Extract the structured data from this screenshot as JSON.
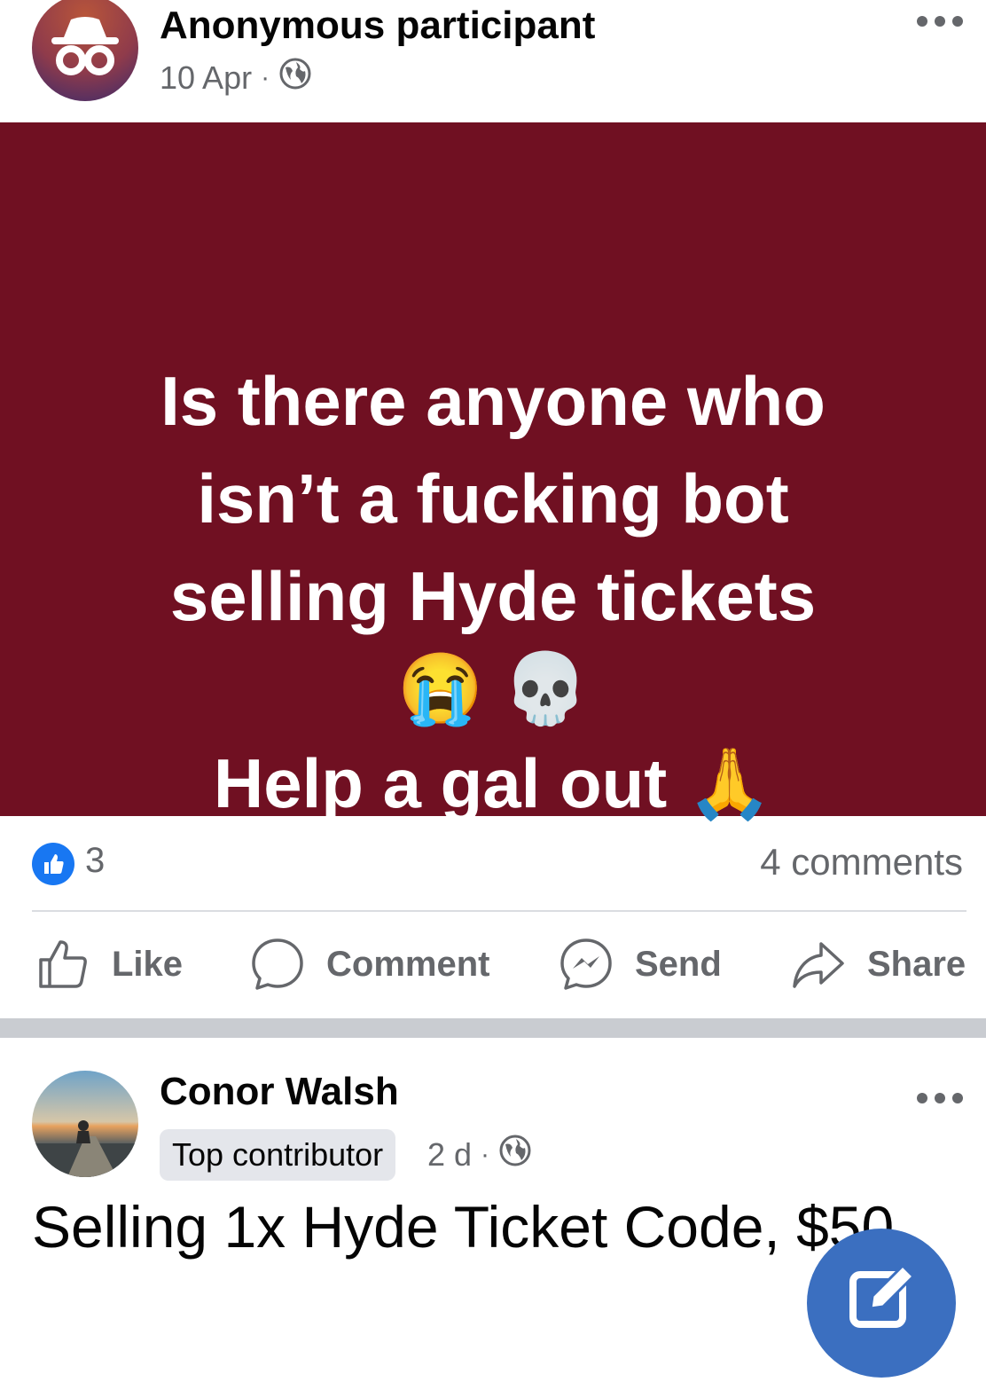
{
  "posts": [
    {
      "author": "Anonymous participant",
      "date": "10 Apr",
      "separator": "·",
      "audience_icon": "globe-icon",
      "banner": {
        "background": "#701022",
        "lines": [
          "Is there anyone who",
          "isn’t a fucking bot",
          "selling Hyde tickets",
          "😭 💀",
          "Help a gal out 🙏"
        ]
      },
      "reactions": {
        "count": "3",
        "icon": "like-icon"
      },
      "comments": "4 comments",
      "actions": {
        "like": "Like",
        "comment": "Comment",
        "send": "Send",
        "share": "Share"
      }
    },
    {
      "author": "Conor Walsh",
      "badge": "Top contributor",
      "date": "2 d",
      "separator": "·",
      "audience_icon": "globe-icon",
      "text": "Selling 1x Hyde Ticket Code, $50"
    }
  ],
  "colors": {
    "accent": "#1877f2",
    "banner": "#701022",
    "secondary_text": "#65676b",
    "fab": "#3b6fc0"
  }
}
